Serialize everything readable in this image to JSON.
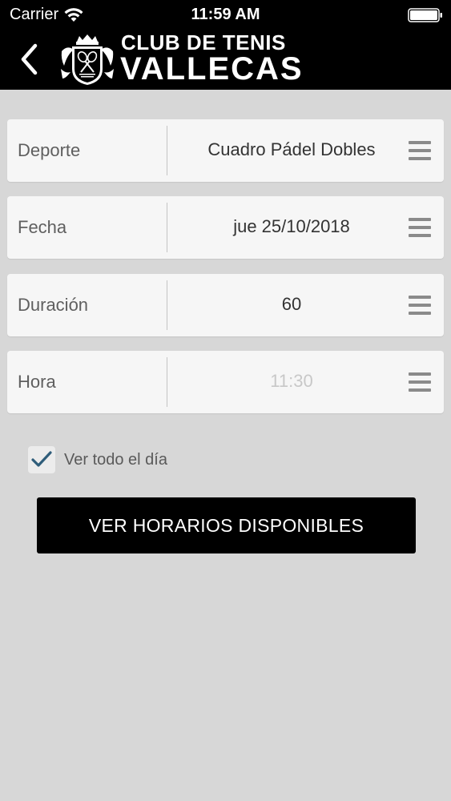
{
  "status_bar": {
    "carrier": "Carrier",
    "time": "11:59 AM",
    "wifi_icon": "wifi-icon",
    "battery_icon": "battery-icon"
  },
  "header": {
    "back_icon": "chevron-left-icon",
    "logo_icon": "club-crest-logo",
    "brand_line1": "CLUB DE TENIS",
    "brand_line2": "VALLECAS"
  },
  "form": {
    "rows": [
      {
        "label": "Deporte",
        "value": "Cuadro Pádel Dobles",
        "is_placeholder": false
      },
      {
        "label": "Fecha",
        "value": "jue 25/10/2018",
        "is_placeholder": false
      },
      {
        "label": "Duración",
        "value": "60",
        "is_placeholder": false
      },
      {
        "label": "Hora",
        "value": "11:30",
        "is_placeholder": true
      }
    ],
    "row_menu_icon": "menu-icon"
  },
  "options": {
    "show_all_day_label": "Ver todo el día",
    "show_all_day_checked": true
  },
  "actions": {
    "submit_label": "VER HORARIOS DISPONIBLES"
  },
  "colors": {
    "header_bg": "#000000",
    "page_bg": "#d7d7d7",
    "row_bg": "#f6f6f6",
    "check_color": "#2f5d7a",
    "button_bg": "#000000"
  }
}
